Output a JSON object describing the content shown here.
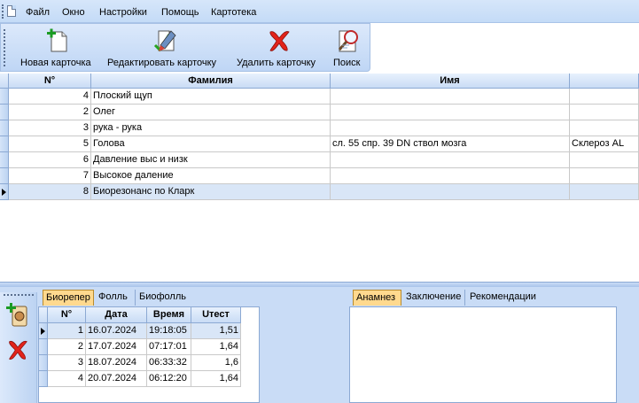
{
  "menu": {
    "items": [
      "Файл",
      "Окно",
      "Настройки",
      "Помощь",
      "Картотека"
    ]
  },
  "toolbar": {
    "new_label": "Новая карточка",
    "edit_label": "Редактировать карточку",
    "delete_label": "Удалить карточку",
    "search_label": "Поиск"
  },
  "grid": {
    "columns": [
      "N°",
      "Фамилия",
      "Имя",
      ""
    ],
    "rows": [
      {
        "n": "4",
        "surname": "Плоский щуп",
        "name": "",
        "extra": ""
      },
      {
        "n": "2",
        "surname": "Олег",
        "name": "",
        "extra": ""
      },
      {
        "n": "3",
        "surname": "рука - рука",
        "name": "",
        "extra": ""
      },
      {
        "n": "5",
        "surname": "Голова",
        "name": "сл. 55 спр. 39 DN ствол мозга",
        "extra": "Склероз AL"
      },
      {
        "n": "6",
        "surname": "Давление выс и низк",
        "name": "",
        "extra": ""
      },
      {
        "n": "7",
        "surname": "Высокое даление",
        "name": "",
        "extra": ""
      },
      {
        "n": "8",
        "surname": "Биорезонанс по Кларк",
        "name": "",
        "extra": ""
      }
    ]
  },
  "left_tabs": [
    "Биорепер",
    "Фолль",
    "Биофолль"
  ],
  "right_tabs": [
    "Анамнез",
    "Заключение",
    "Рекомендации"
  ],
  "subgrid": {
    "columns": [
      "N°",
      "Дата",
      "Время",
      "Uтест"
    ],
    "rows": [
      {
        "n": "1",
        "date": "16.07.2024",
        "time": "19:18:05",
        "u": "1,51"
      },
      {
        "n": "2",
        "date": "17.07.2024",
        "time": "07:17:01",
        "u": "1,64"
      },
      {
        "n": "3",
        "date": "18.07.2024",
        "time": "06:33:32",
        "u": "1,6"
      },
      {
        "n": "4",
        "date": "20.07.2024",
        "time": "06:12:20",
        "u": "1,64"
      }
    ]
  },
  "icons": {
    "new": "new-card-icon",
    "edit": "edit-card-icon",
    "delete": "delete-card-icon",
    "search": "search-icon",
    "side_add": "add-record-icon",
    "side_delete": "delete-record-icon"
  }
}
